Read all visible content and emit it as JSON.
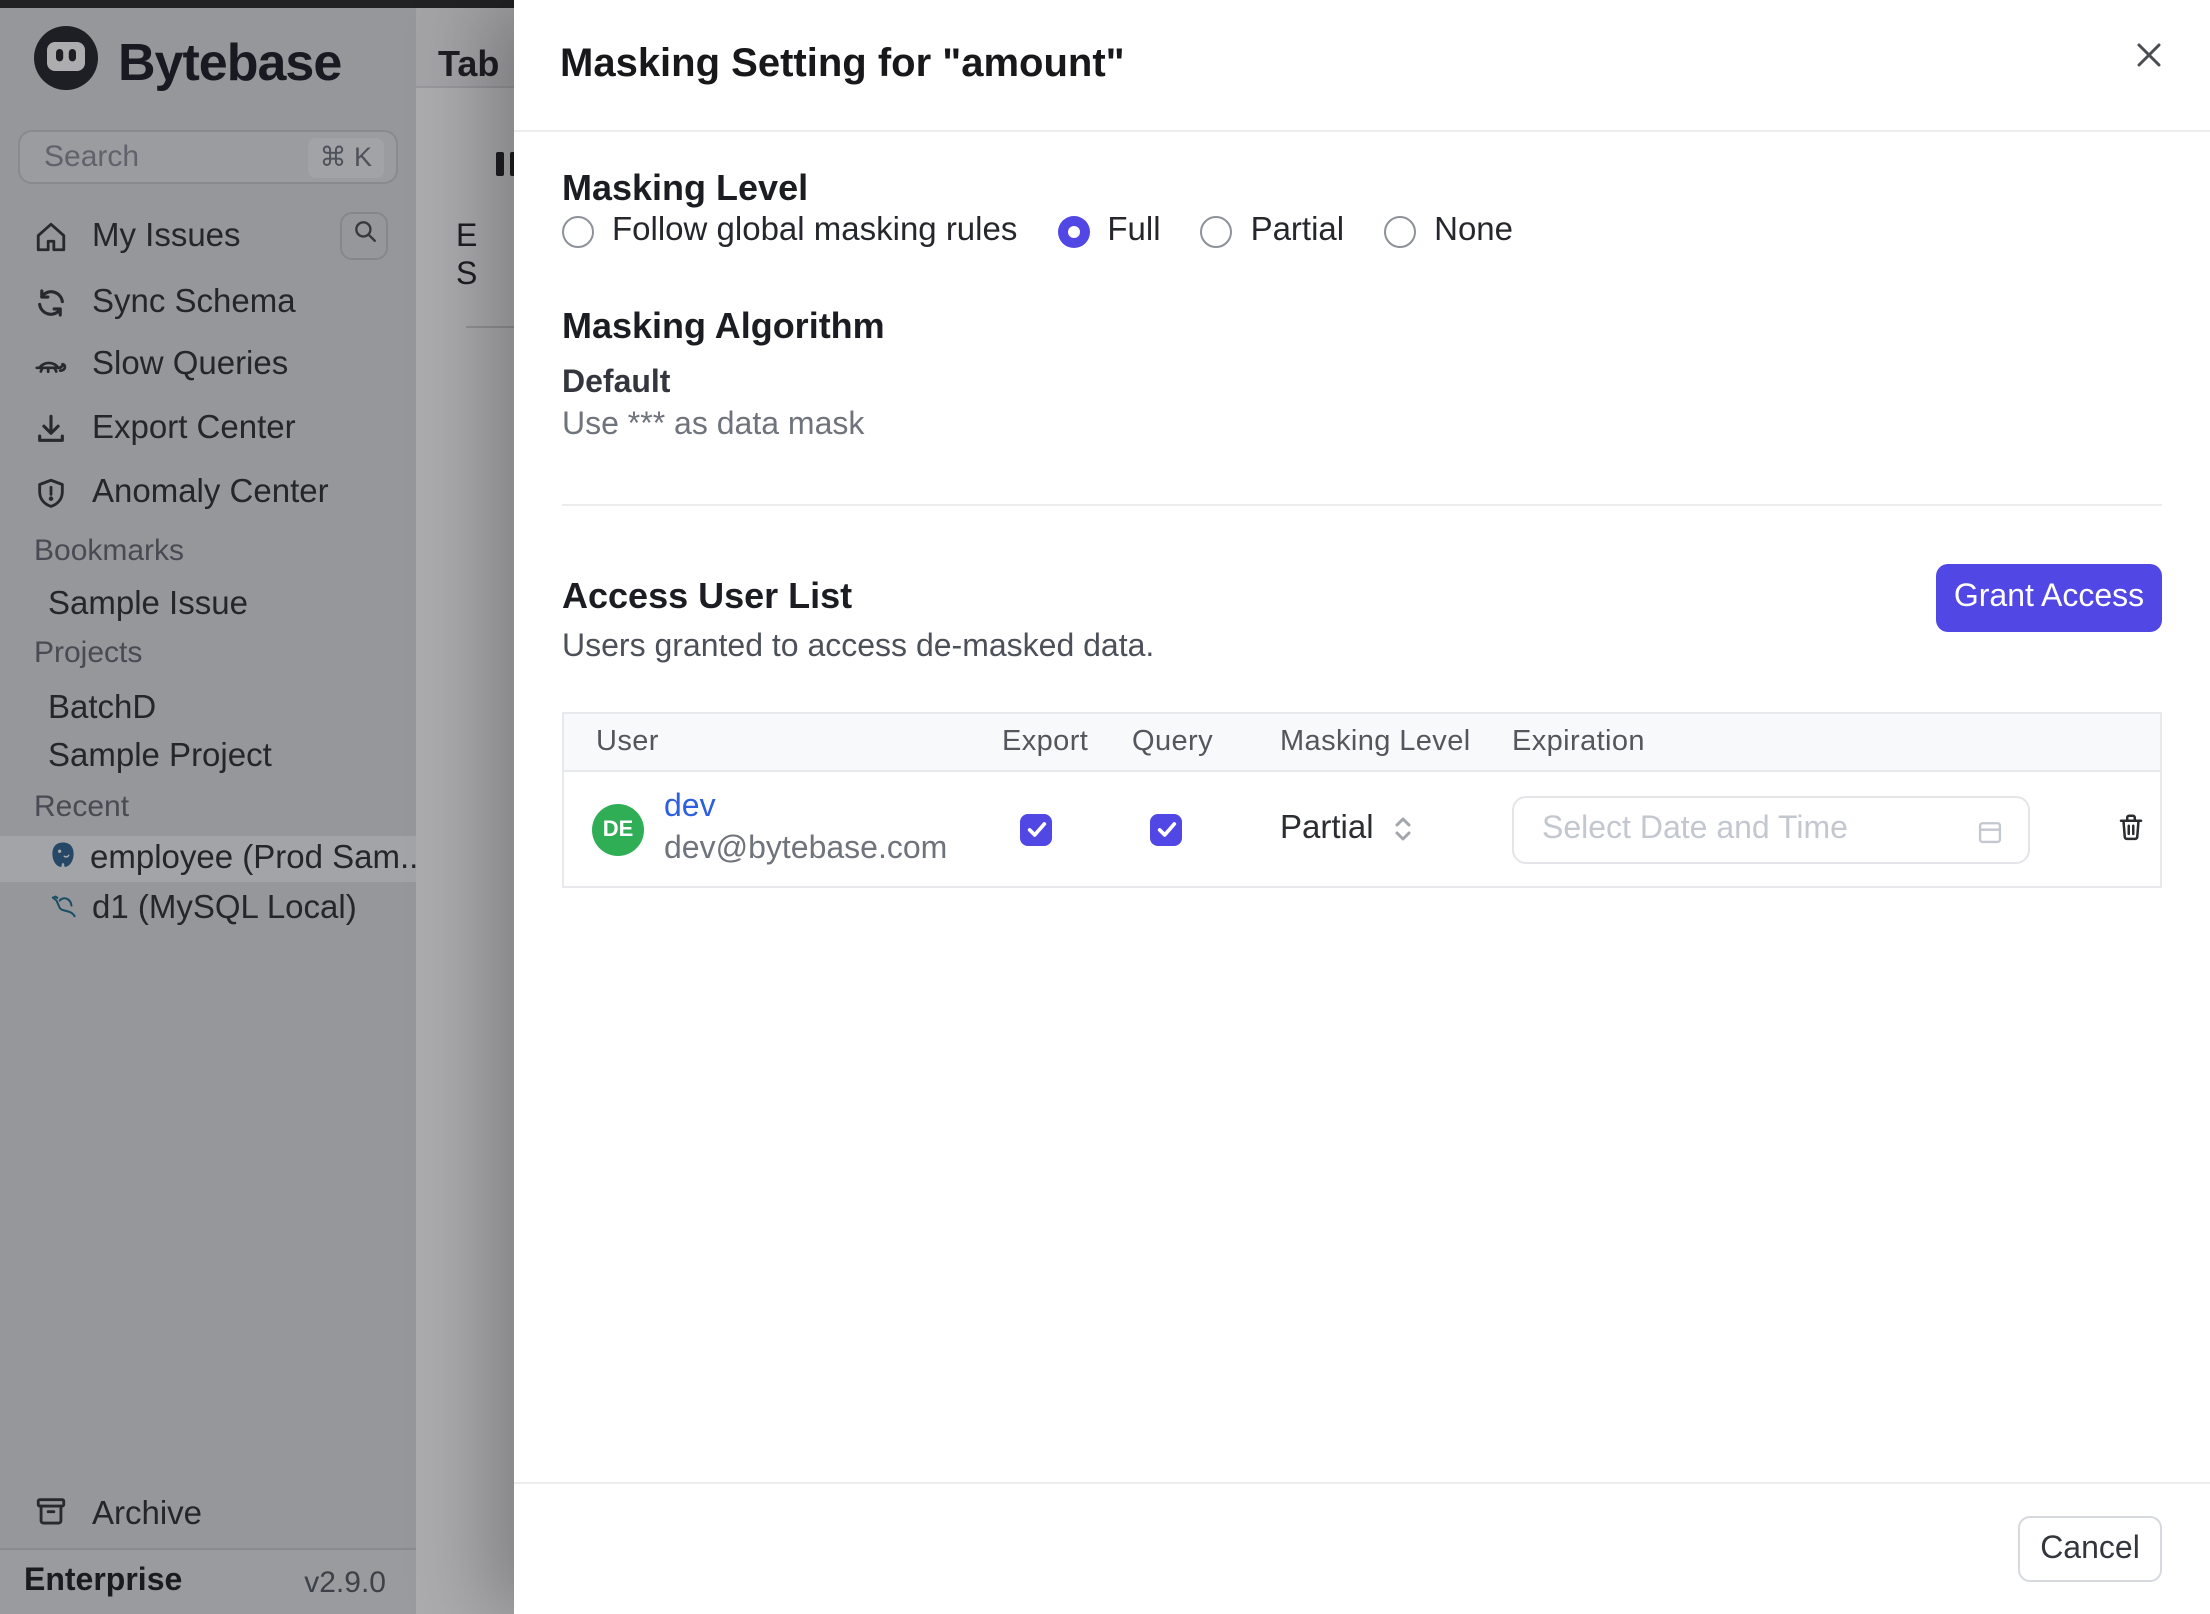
{
  "colors": {
    "accent": "#5147e5",
    "avatar_green": "#2fae55",
    "link_blue": "#2e5fe0"
  },
  "sidebar": {
    "logo_text": "Bytebase",
    "search": {
      "placeholder": "Search",
      "shortcut": "⌘ K"
    },
    "nav": [
      {
        "icon": "home-icon",
        "label": "My Issues"
      },
      {
        "icon": "sync-icon",
        "label": "Sync Schema"
      },
      {
        "icon": "turtle-icon",
        "label": "Slow Queries"
      },
      {
        "icon": "download-icon",
        "label": "Export Center"
      },
      {
        "icon": "shield-icon",
        "label": "Anomaly Center"
      }
    ],
    "sections": [
      {
        "title": "Bookmarks",
        "items": [
          {
            "label": "Sample Issue"
          }
        ]
      },
      {
        "title": "Projects",
        "items": [
          {
            "label": "BatchD"
          },
          {
            "label": "Sample Project"
          }
        ]
      },
      {
        "title": "Recent",
        "items": [
          {
            "label": "employee (Prod Sam...",
            "icon": "postgres-icon",
            "selected": true
          },
          {
            "label": "d1 (MySQL Local)",
            "icon": "mysql-icon",
            "selected": false
          }
        ]
      }
    ],
    "archive_label": "Archive",
    "footer": {
      "plan": "Enterprise",
      "version": "v2.9.0"
    }
  },
  "background_page": {
    "tab_label": "Tab",
    "partial_labels": {
      "line1": "E",
      "line2": "S"
    }
  },
  "modal": {
    "title": "Masking Setting for \"amount\"",
    "masking_level": {
      "heading": "Masking Level",
      "options": [
        {
          "label": "Follow global masking rules",
          "selected": false
        },
        {
          "label": "Full",
          "selected": true
        },
        {
          "label": "Partial",
          "selected": false
        },
        {
          "label": "None",
          "selected": false
        }
      ]
    },
    "masking_algorithm": {
      "heading": "Masking Algorithm",
      "name": "Default",
      "description": "Use *** as data mask"
    },
    "access_user_list": {
      "heading": "Access User List",
      "description": "Users granted to access de-masked data.",
      "grant_button": "Grant Access",
      "table": {
        "columns": [
          "User",
          "Export",
          "Query",
          "Masking Level",
          "Expiration"
        ],
        "rows": [
          {
            "avatar_initials": "DE",
            "name": "dev",
            "email": "dev@bytebase.com",
            "export_checked": true,
            "query_checked": true,
            "masking_level": "Partial",
            "expiration_placeholder": "Select Date and Time"
          }
        ]
      }
    },
    "cancel_label": "Cancel"
  }
}
